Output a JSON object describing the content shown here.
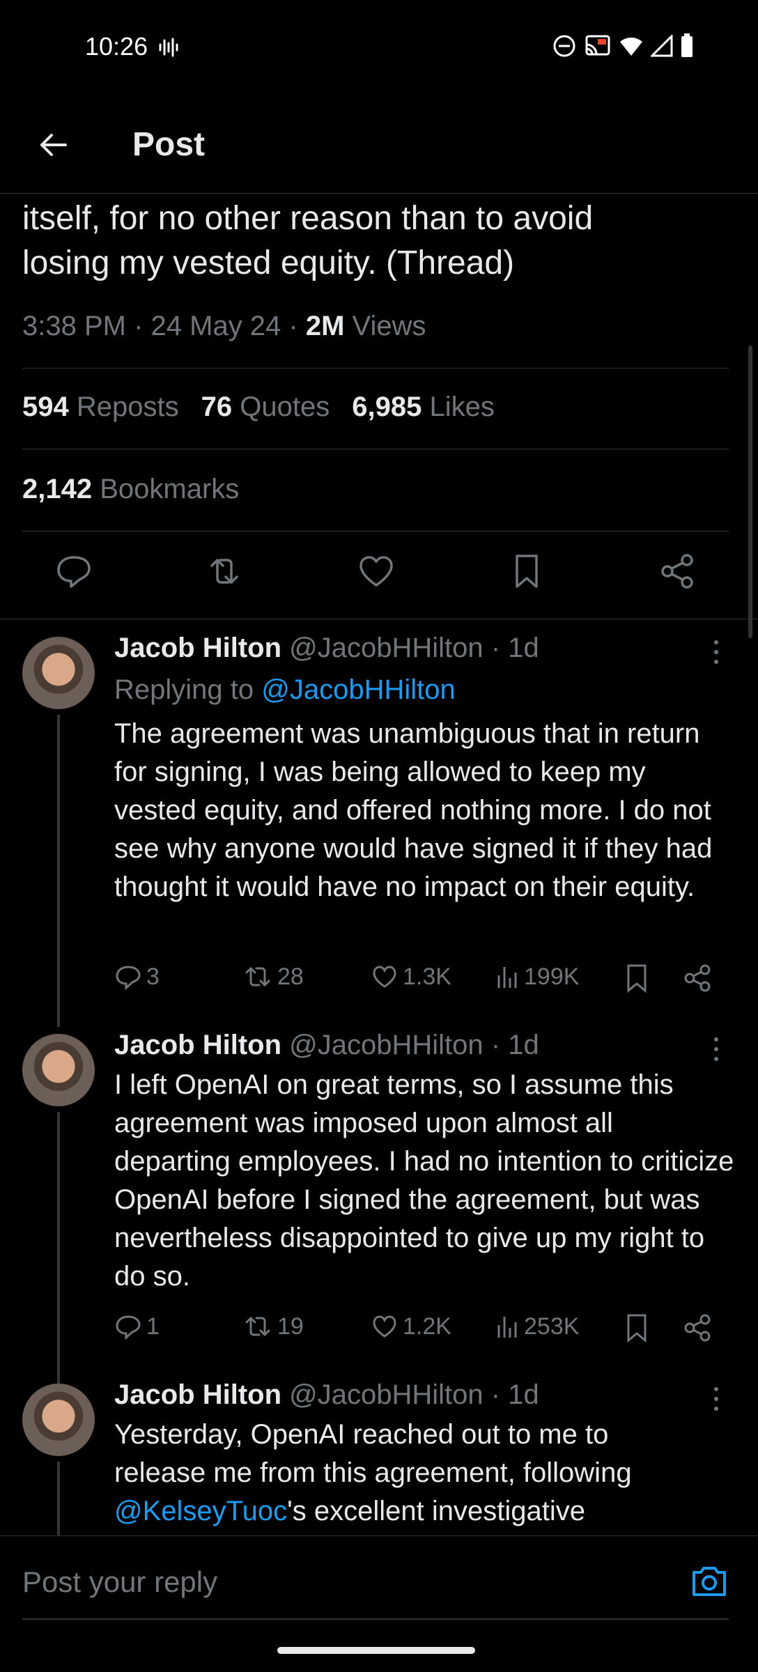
{
  "status_bar": {
    "time": "10:26"
  },
  "header": {
    "title": "Post"
  },
  "post": {
    "text_line1": "itself, for no other reason than to avoid",
    "text_line2": "losing my vested equity. (Thread)",
    "time": "3:38 PM",
    "date": "24 May 24",
    "views_count": "2M",
    "views_label": "Views",
    "reposts_count": "594",
    "reposts_label": "Reposts",
    "quotes_count": "76",
    "quotes_label": "Quotes",
    "likes_count": "6,985",
    "likes_label": "Likes",
    "bookmarks_count": "2,142",
    "bookmarks_label": "Bookmarks"
  },
  "replies": [
    {
      "name": "Jacob Hilton",
      "handle": "@JacobHHilton",
      "age": "1d",
      "replying_prefix": "Replying to",
      "replying_to": "@JacobHHilton",
      "body": "The agreement was unambiguous that in return for signing, I was being allowed to keep my vested equity, and offered nothing more. I do not see why anyone would have signed it if they had thought it would have no impact on their equity.",
      "reply_count": "3",
      "repost_count": "28",
      "like_count": "1.3K",
      "view_count": "199K"
    },
    {
      "name": "Jacob Hilton",
      "handle": "@JacobHHilton",
      "age": "1d",
      "body": "I left OpenAI on great terms, so I assume this agreement was imposed upon almost all departing employees. I had no intention to criticize OpenAI before I signed the agreement, but was nevertheless disappointed to give up my right to do so.",
      "reply_count": "1",
      "repost_count": "19",
      "like_count": "1.2K",
      "view_count": "253K"
    },
    {
      "name": "Jacob Hilton",
      "handle": "@JacobHHilton",
      "age": "1d",
      "body_line1": "Yesterday, OpenAI reached out to me to",
      "body_line2": "release me from this agreement, following",
      "mention": "@KelseyTuoc",
      "body_line3_rest": "'s excellent investigative"
    }
  ],
  "compose": {
    "placeholder": "Post your reply"
  },
  "colors": {
    "background": "#000000",
    "text": "#e7e9ea",
    "muted": "#71767b",
    "link": "#1d9bf0",
    "divider": "#2f3336"
  }
}
